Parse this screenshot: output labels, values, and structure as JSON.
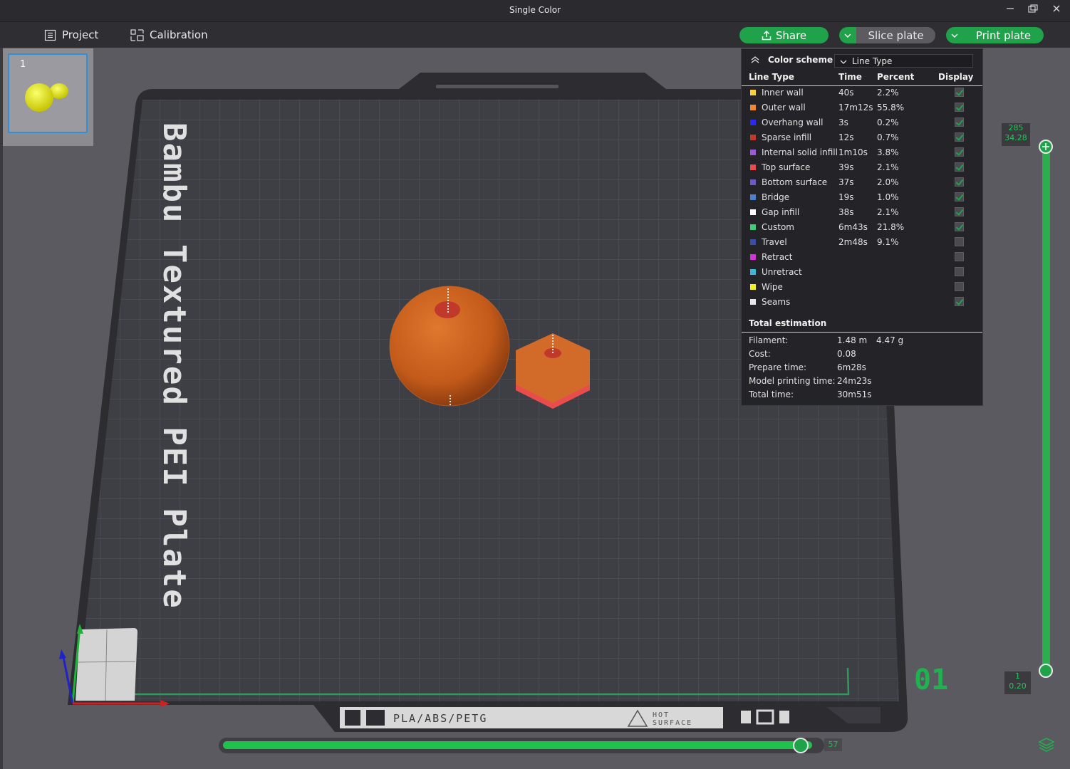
{
  "window": {
    "title": "Single Color",
    "controls": [
      "minimize-icon",
      "restore-icon",
      "close-icon"
    ]
  },
  "toolbar": {
    "project_label": "Project",
    "calibration_label": "Calibration",
    "share_label": "Share",
    "slice_label": "Slice plate",
    "print_label": "Print plate",
    "accent_color": "#1fa24a"
  },
  "plate_list": {
    "items": [
      {
        "number": "1"
      }
    ]
  },
  "bed": {
    "title": "Bambu Textured PEI Plate",
    "front_label": "PLA/ABS/PETG",
    "warning_label_line1": "HOT",
    "warning_label_line2": "SURFACE",
    "plate_number": "01"
  },
  "legend": {
    "scheme_label": "Color scheme",
    "scheme_value": "Line Type",
    "headers": {
      "type": "Line Type",
      "time": "Time",
      "percent": "Percent",
      "display": "Display"
    },
    "rows": [
      {
        "name": "Inner wall",
        "time": "40s",
        "percent": "2.2%",
        "color": "#f5d03a",
        "display": true
      },
      {
        "name": "Outer wall",
        "time": "17m12s",
        "percent": "55.8%",
        "color": "#f08a2e",
        "display": true
      },
      {
        "name": "Overhang wall",
        "time": "3s",
        "percent": "0.2%",
        "color": "#2a2af0",
        "display": true
      },
      {
        "name": "Sparse infill",
        "time": "12s",
        "percent": "0.7%",
        "color": "#c0392b",
        "display": true
      },
      {
        "name": "Internal solid infill",
        "time": "1m10s",
        "percent": "3.8%",
        "color": "#9b59d6",
        "display": true
      },
      {
        "name": "Top surface",
        "time": "39s",
        "percent": "2.1%",
        "color": "#e84c4c",
        "display": true
      },
      {
        "name": "Bottom surface",
        "time": "37s",
        "percent": "2.0%",
        "color": "#6a5acd",
        "display": true
      },
      {
        "name": "Bridge",
        "time": "19s",
        "percent": "1.0%",
        "color": "#4a7fc9",
        "display": true
      },
      {
        "name": "Gap infill",
        "time": "38s",
        "percent": "2.1%",
        "color": "#ffffff",
        "display": true
      },
      {
        "name": "Custom",
        "time": "6m43s",
        "percent": "21.8%",
        "color": "#3ccf7a",
        "display": true
      },
      {
        "name": "Travel",
        "time": "2m48s",
        "percent": "9.1%",
        "color": "#3a4fa8",
        "display": false
      },
      {
        "name": "Retract",
        "time": "",
        "percent": "",
        "color": "#d633d6",
        "display": false
      },
      {
        "name": "Unretract",
        "time": "",
        "percent": "",
        "color": "#3db6d8",
        "display": false
      },
      {
        "name": "Wipe",
        "time": "",
        "percent": "",
        "color": "#f2f21a",
        "display": false
      },
      {
        "name": "Seams",
        "time": "",
        "percent": "",
        "color": "#e8e8e8",
        "display": true
      }
    ],
    "total_title": "Total estimation",
    "totals": [
      {
        "label": "Filament:",
        "value": "1.48 m",
        "value2": "4.47 g"
      },
      {
        "label": "Cost:",
        "value": "0.08",
        "value2": ""
      },
      {
        "label": "Prepare time:",
        "value": "6m28s",
        "value2": ""
      },
      {
        "label": "Model printing time:",
        "value": "24m23s",
        "value2": ""
      },
      {
        "label": "Total time:",
        "value": "30m51s",
        "value2": ""
      }
    ]
  },
  "layer_slider": {
    "top_layer": "285",
    "top_height": "34.28",
    "bottom_layer": "1",
    "bottom_height": "0.20"
  },
  "move_slider": {
    "value": "57",
    "fraction": 0.98
  }
}
